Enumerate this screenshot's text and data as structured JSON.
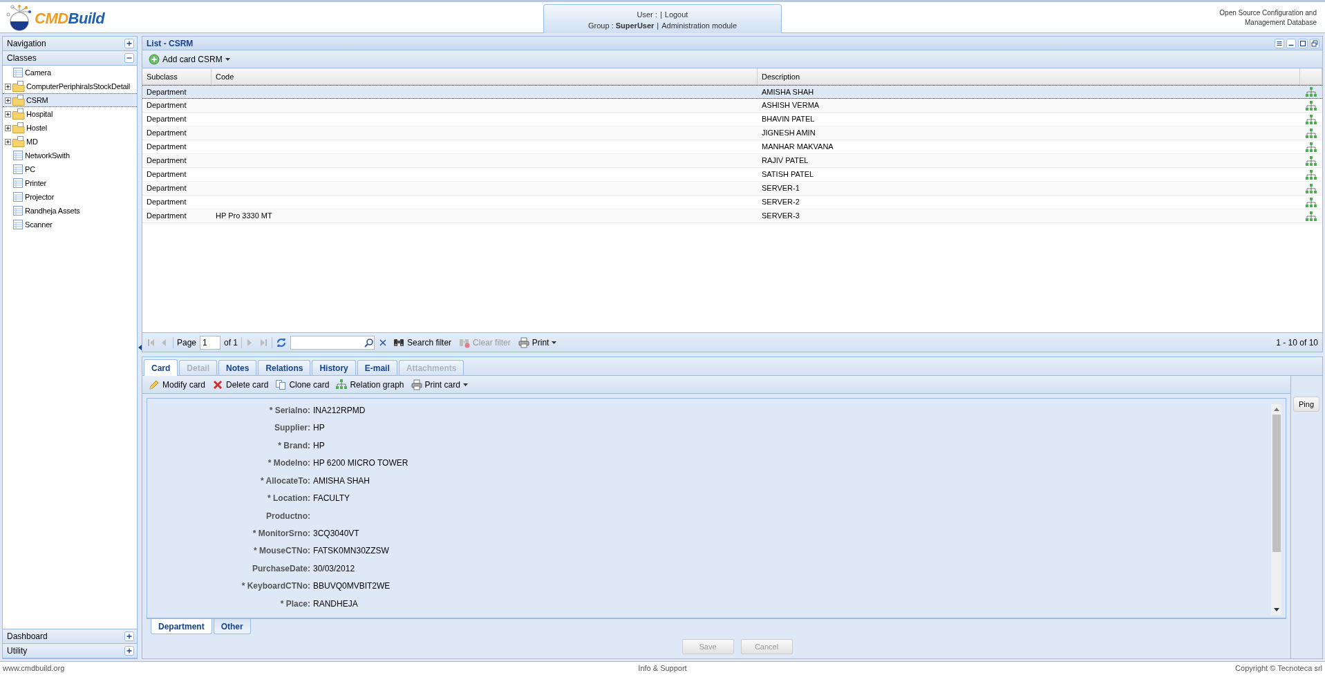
{
  "header": {
    "logo": {
      "parts": [
        "CMD",
        "Build"
      ]
    },
    "user_label": "User :",
    "separator": "|",
    "logout": "Logout",
    "group_label": "Group : **SuperUser**",
    "separator_2": "|",
    "admin_link": "Administration module",
    "tagline": "Open Source Configuration and\nManagement Database"
  },
  "sidebar": {
    "sections": [
      {
        "title": "Navigation",
        "expanded": false
      },
      {
        "title": "Classes",
        "expanded": true,
        "items": [
          {
            "label": "Camera",
            "kind": "class",
            "selected": false
          },
          {
            "label": "ComputerPeriphiralsStockDetail",
            "kind": "folder",
            "expanded": false,
            "selected": false
          },
          {
            "label": "CSRM",
            "kind": "folder",
            "expanded": false,
            "selected": true
          },
          {
            "label": "Hospital",
            "kind": "folder",
            "expanded": false,
            "selected": false
          },
          {
            "label": "Hostel",
            "kind": "folder",
            "expanded": false,
            "selected": false
          },
          {
            "label": "MD",
            "kind": "folder",
            "expanded": false,
            "selected": false
          },
          {
            "label": "NetworkSwith",
            "kind": "class",
            "selected": false
          },
          {
            "label": "PC",
            "kind": "class",
            "selected": false
          },
          {
            "label": "Printer",
            "kind": "class",
            "selected": false
          },
          {
            "label": "Projector",
            "kind": "class",
            "selected": false
          },
          {
            "label": "Randheja Assets",
            "kind": "class",
            "selected": false
          },
          {
            "label": "Scanner",
            "kind": "class",
            "selected": false
          }
        ]
      },
      {
        "title": "Dashboard",
        "expanded": false
      },
      {
        "title": "Utility",
        "expanded": false
      }
    ]
  },
  "list": {
    "title": "List - CSRM",
    "add_button": "Add card CSRM",
    "columns": [
      "Subclass",
      "Code",
      "Description"
    ],
    "rows": [
      {
        "subclass": "Department",
        "description": "AMISHA SHAH",
        "selected": true
      },
      {
        "subclass": "Department",
        "description": "ASHISH VERMA",
        "selected": false
      },
      {
        "subclass": "Department",
        "description": "BHAVIN PATEL",
        "selected": false
      },
      {
        "subclass": "Department",
        "description": "JIGNESH AMIN",
        "selected": false
      },
      {
        "subclass": "Department",
        "description": "MANHAR MAKVANA",
        "selected": false
      },
      {
        "subclass": "Department",
        "description": "RAJIV PATEL",
        "selected": false
      },
      {
        "subclass": "Department",
        "description": "SATISH PATEL",
        "selected": false
      },
      {
        "subclass": "Department",
        "description": "SERVER-1",
        "selected": false
      },
      {
        "subclass": "Department",
        "description": "SERVER-2",
        "selected": false
      },
      {
        "subclass": "Department",
        "code": "HP Pro 3330 MT",
        "description": "SERVER-3",
        "selected": false
      }
    ],
    "paging": {
      "page_label": "Page",
      "page": "1",
      "of": "of 1",
      "search_filter": "Search filter",
      "clear_filter": {
        "label": "Clear filter",
        "disabled": true
      },
      "print": "Print",
      "summary": "1 - 10 of 10"
    }
  },
  "detail": {
    "tabs": [
      {
        "label": "Card",
        "selected": true,
        "disabled": false
      },
      {
        "label": "Detail",
        "selected": false,
        "disabled": true
      },
      {
        "label": "Notes",
        "selected": false,
        "disabled": false
      },
      {
        "label": "Relations",
        "selected": false,
        "disabled": false
      },
      {
        "label": "History",
        "selected": false,
        "disabled": false
      },
      {
        "label": "E-mail",
        "selected": false,
        "disabled": false
      },
      {
        "label": "Attachments",
        "selected": false,
        "disabled": true
      }
    ],
    "toolbar": [
      {
        "kind": "modify",
        "label": "Modify card",
        "menu": false
      },
      {
        "kind": "delete",
        "label": "Delete card",
        "menu": false
      },
      {
        "kind": "clone",
        "label": "Clone card",
        "menu": false
      },
      {
        "kind": "graph",
        "label": "Relation graph",
        "menu": false
      },
      {
        "kind": "print",
        "label": "Print card",
        "menu": true
      }
    ],
    "fields": [
      {
        "label": "* Serialno:",
        "value": "INA212RPMD"
      },
      {
        "label": "Supplier:",
        "value": "HP"
      },
      {
        "label": "* Brand:",
        "value": "HP"
      },
      {
        "label": "* Modelno:",
        "value": "HP 6200 MICRO TOWER"
      },
      {
        "label": "* AllocateTo:",
        "value": "AMISHA SHAH"
      },
      {
        "label": "* Location:",
        "value": "FACULTY"
      },
      {
        "label": "Productno:"
      },
      {
        "label": "* MonitorSrno:",
        "value": "3CQ3040VT"
      },
      {
        "label": "* MouseCTNo:",
        "value": "FATSK0MN30ZZSW"
      },
      {
        "label": "PurchaseDate:",
        "value": "30/03/2012"
      },
      {
        "label": "* KeyboardCTNo:",
        "value": "BBUVQ0MVBIT2WE"
      },
      {
        "label": "* Place:",
        "value": "RANDHEJA"
      }
    ],
    "form_tabs": [
      {
        "label": "Department",
        "selected": true
      },
      {
        "label": "Other",
        "selected": false
      }
    ],
    "buttons": [
      {
        "label": "Save",
        "disabled": true
      },
      {
        "label": "Cancel",
        "disabled": true
      }
    ],
    "side_button": "Ping"
  },
  "footer": {
    "left": "www.cmdbuild.org",
    "center": "Info & Support",
    "right": "Copyright © Tecnoteca srl"
  }
}
